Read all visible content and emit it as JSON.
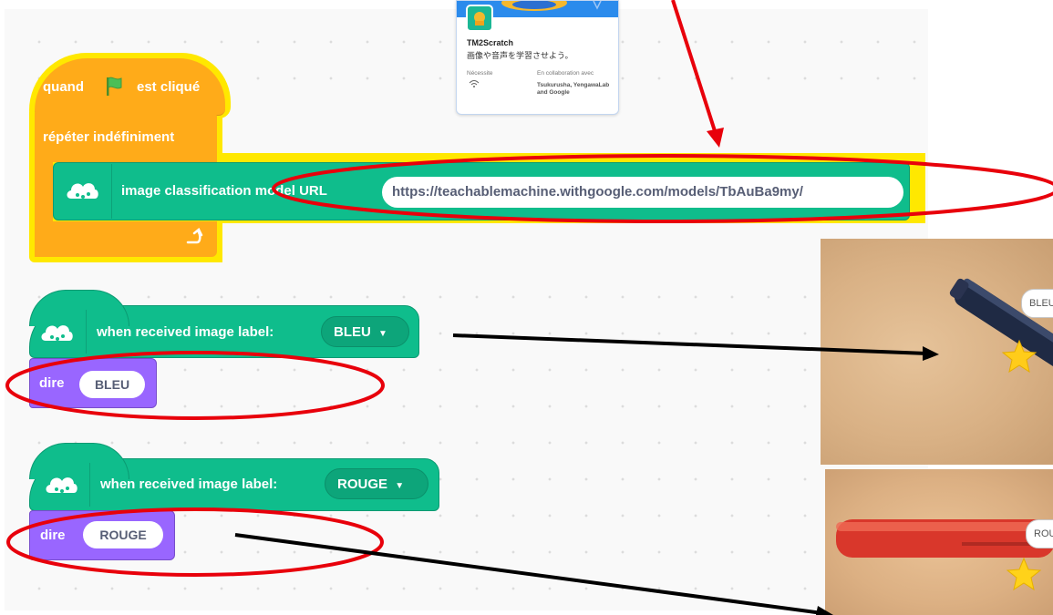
{
  "card": {
    "title": "TM2Scratch",
    "subtitle": "画像や音声を学習させよう。",
    "requires_label": "Nécessite",
    "collab_label": "En collaboration avec",
    "collab_names": "Tsukurusha, YengawaLab and Google"
  },
  "script1": {
    "hat_left": "quand",
    "hat_right": "est cliqué",
    "loop_label": "répéter indéfiniment",
    "classify_label": "image classification model URL",
    "model_url": "https://teachablemachine.withgoogle.com/models/TbAuBa9my/"
  },
  "script2": {
    "hat_label": "when received image label:",
    "dropdown_value": "BLEU",
    "say_label": "dire",
    "say_value": "BLEU"
  },
  "script3": {
    "hat_label": "when received image label:",
    "dropdown_value": "ROUGE",
    "say_label": "dire",
    "say_value": "ROUGE"
  },
  "photos": {
    "bubble1": "BLEU",
    "bubble2": "ROUGE"
  },
  "colors": {
    "events": "#ffab19",
    "extension": "#0fbd8c",
    "looks": "#9966ff",
    "highlight": "#ffe800",
    "annotation_red": "#e8000b",
    "annotation_arrow": "#000000"
  }
}
